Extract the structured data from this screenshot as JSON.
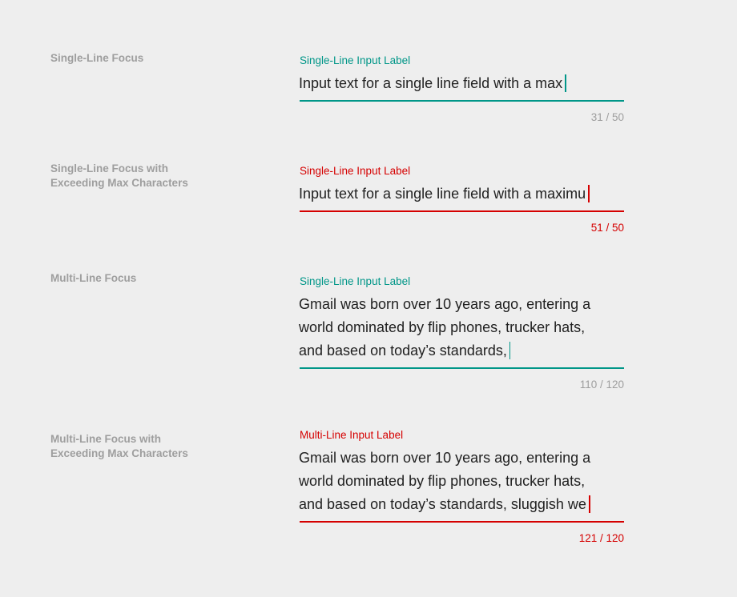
{
  "colors": {
    "background": "#eeeeee",
    "caption": "#9e9e9e",
    "focus": "#009688",
    "error": "#d50000",
    "input_text": "#212121",
    "counter": "#9e9e9e"
  },
  "rows": [
    {
      "caption": "Single-Line Focus",
      "state": "focus",
      "label": "Single-Line Input Label",
      "lines": [
        "Input text for a single line field with a max"
      ],
      "counter": "31 / 50"
    },
    {
      "caption": "Single-Line Focus with\nExceeding Max Characters",
      "state": "error",
      "label": "Single-Line Input Label",
      "lines": [
        "Input text for a single line field with a maximu"
      ],
      "counter": "51 / 50"
    },
    {
      "caption": "Multi-Line Focus",
      "state": "focus",
      "label": "Single-Line Input Label",
      "lines": [
        "Gmail was born over 10 years ago, entering a",
        "world dominated by flip phones, trucker hats,",
        "and based on today’s standards,"
      ],
      "counter": "110 / 120"
    },
    {
      "caption": "Multi-Line Focus with\nExceeding Max Characters",
      "state": "error",
      "label": "Multi-Line Input Label",
      "lines": [
        "Gmail was born over 10 years ago, entering a",
        "world dominated by flip phones, trucker hats,",
        "and based on today’s standards, sluggish we"
      ],
      "counter": "121 / 120"
    }
  ]
}
